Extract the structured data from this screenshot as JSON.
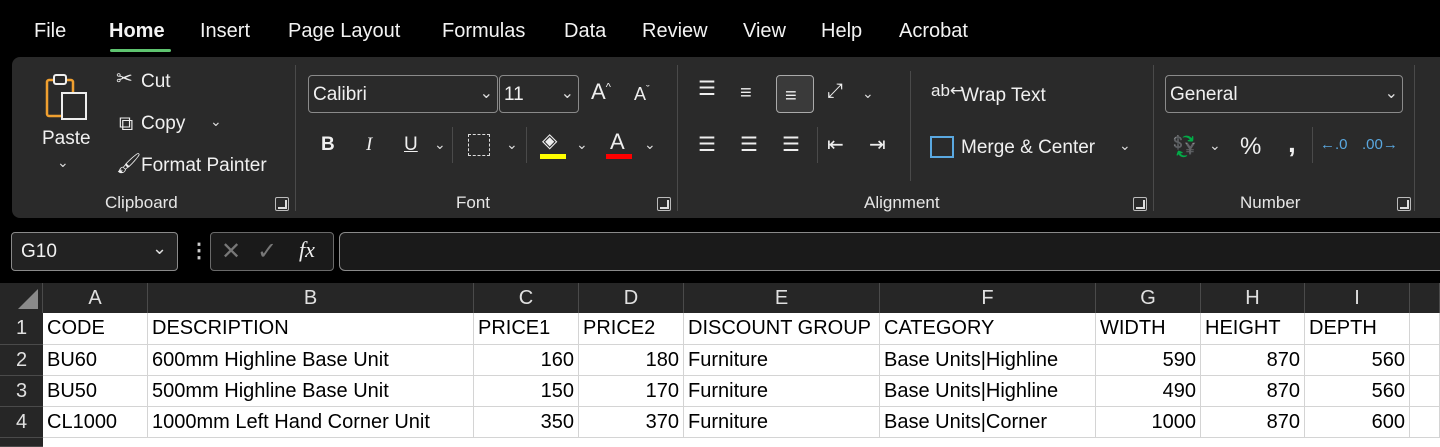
{
  "menu": {
    "tabs": [
      "File",
      "Home",
      "Insert",
      "Page Layout",
      "Formulas",
      "Data",
      "Review",
      "View",
      "Help",
      "Acrobat"
    ],
    "active": "Home"
  },
  "ribbon": {
    "clipboard": {
      "paste": "Paste",
      "cut": "Cut",
      "copy": "Copy",
      "format_painter": "Format Painter",
      "group_label": "Clipboard"
    },
    "font": {
      "family": "Calibri",
      "size": "11",
      "bold": "B",
      "italic": "I",
      "underline": "U",
      "group_label": "Font",
      "highlight_color": "#ffff00",
      "font_color": "#ff0000"
    },
    "alignment": {
      "wrap_text": "Wrap Text",
      "merge_center": "Merge & Center",
      "group_label": "Alignment"
    },
    "number": {
      "format": "General",
      "percent": "%",
      "comma": ",",
      "group_label": "Number"
    }
  },
  "formula_bar": {
    "name_box": "G10",
    "fx": "fx",
    "formula": ""
  },
  "sheet": {
    "columns": [
      "A",
      "B",
      "C",
      "D",
      "E",
      "F",
      "G",
      "H",
      "I"
    ],
    "rows": [
      {
        "num": "1",
        "cells": [
          "CODE",
          "DESCRIPTION",
          "PRICE1",
          "PRICE2",
          "DISCOUNT GROUP",
          "CATEGORY",
          "WIDTH",
          "HEIGHT",
          "DEPTH"
        ]
      },
      {
        "num": "2",
        "cells": [
          "BU60",
          "600mm Highline Base Unit",
          "160",
          "180",
          "Furniture",
          "Base Units|Highline",
          "590",
          "870",
          "560"
        ]
      },
      {
        "num": "3",
        "cells": [
          "BU50",
          "500mm Highline Base Unit",
          "150",
          "170",
          "Furniture",
          "Base Units|Highline",
          "490",
          "870",
          "560"
        ]
      },
      {
        "num": "4",
        "cells": [
          "CL1000",
          "1000mm Left Hand Corner Unit",
          "350",
          "370",
          "Furniture",
          "Base Units|Corner",
          "1000",
          "870",
          "600"
        ]
      }
    ]
  },
  "colors": {
    "accent": "#5ec36f",
    "ribbon_bg": "#2a2a2a"
  }
}
